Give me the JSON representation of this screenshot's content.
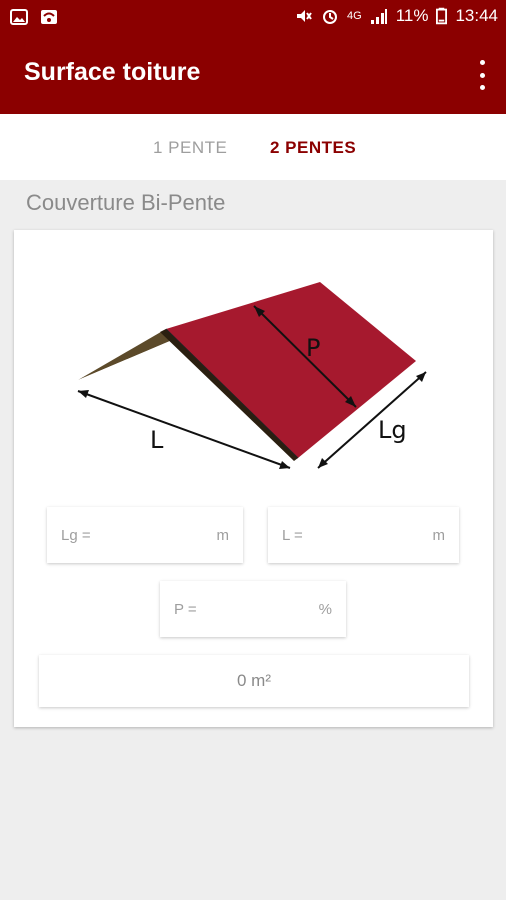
{
  "status_bar": {
    "battery": "11%",
    "time": "13:44",
    "network": "4G"
  },
  "app_bar": {
    "title": "Surface toiture"
  },
  "tabs": [
    {
      "label": "1 PENTE"
    },
    {
      "label": "2 PENTES"
    }
  ],
  "section": {
    "title": "Couverture Bi-Pente"
  },
  "diagram": {
    "label_length": "L",
    "label_width": "Lg",
    "label_slope": "P"
  },
  "fields": {
    "lg": {
      "label": "Lg =",
      "unit": "m"
    },
    "l": {
      "label": "L =",
      "unit": "m"
    },
    "p": {
      "label": "P =",
      "unit": "%"
    }
  },
  "result": {
    "value": "0 m²"
  },
  "colors": {
    "brand": "#8b0000",
    "roof": "#a6192e",
    "roof_dark": "#5c4a2a"
  }
}
